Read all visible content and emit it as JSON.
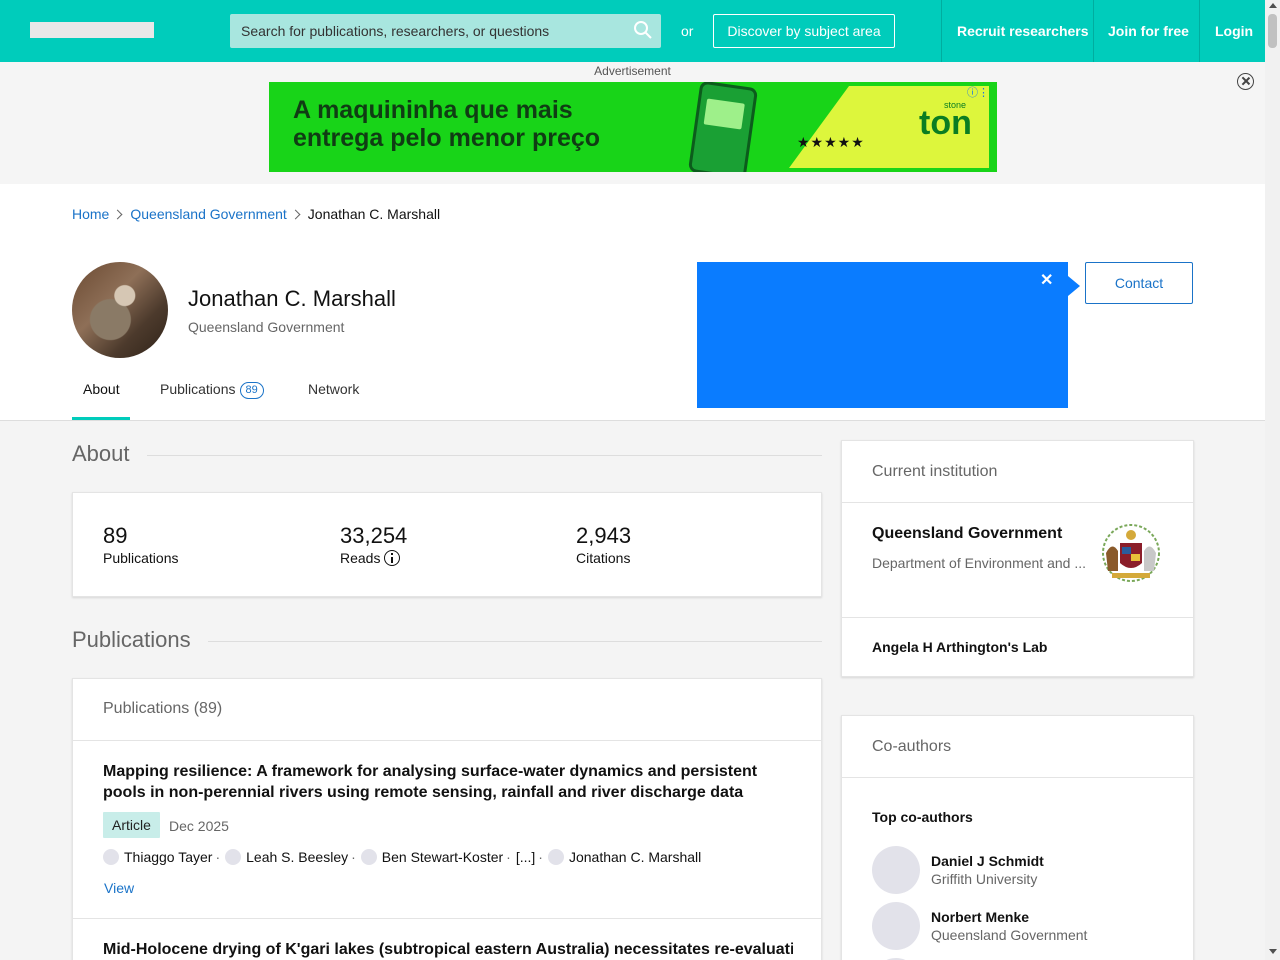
{
  "header": {
    "search_placeholder": "Search for publications, researchers, or questions",
    "or_text": "or",
    "discover_label": "Discover by subject area",
    "recruit_label": "Recruit researchers",
    "join_label": "Join for free",
    "login_label": "Login",
    "brand_color": "#00ccbb"
  },
  "ad": {
    "label": "Advertisement",
    "headline_line1": "A maquininha que mais",
    "headline_line2": "entrega pelo menor preço",
    "stars": "★★★★★",
    "brand": "ton",
    "brand_sub": "stone"
  },
  "breadcrumb": {
    "home": "Home",
    "institution": "Queensland Government",
    "current": "Jonathan C. Marshall"
  },
  "profile": {
    "name": "Jonathan C. Marshall",
    "institution": "Queensland Government",
    "contact_label": "Contact",
    "tabs": [
      {
        "label": "About",
        "active": true
      },
      {
        "label": "Publications",
        "badge": "89"
      },
      {
        "label": "Network"
      }
    ]
  },
  "about": {
    "title": "About",
    "stats": [
      {
        "value": "89",
        "label": "Publications"
      },
      {
        "value": "33,254",
        "label": "Reads"
      },
      {
        "value": "2,943",
        "label": "Citations"
      }
    ]
  },
  "publications": {
    "section_title": "Publications",
    "header": "Publications (89)",
    "items": [
      {
        "title": "Mapping resilience: A framework for analysing surface-water dynamics and persistent pools in non-perennial rivers using remote sensing, rainfall and river discharge data",
        "type": "Article",
        "date": "Dec 2025",
        "authors": [
          "Thiaggo Tayer",
          "Leah S. Beesley",
          "Ben Stewart-Koster",
          "[...]",
          "Jonathan C. Marshall"
        ],
        "view_label": "View"
      },
      {
        "title": "Mid-Holocene drying of K'gari lakes (subtropical eastern Australia) necessitates re-evaluation of"
      }
    ]
  },
  "current_institution": {
    "title": "Current institution",
    "name": "Queensland Government",
    "department": "Department of Environment and ...",
    "lab": "Angela H Arthington's Lab"
  },
  "coauthors": {
    "title": "Co-authors",
    "top_label": "Top co-authors",
    "items": [
      {
        "name": "Daniel J Schmidt",
        "institution": "Griffith University"
      },
      {
        "name": "Norbert Menke",
        "institution": "Queensland Government"
      }
    ]
  }
}
